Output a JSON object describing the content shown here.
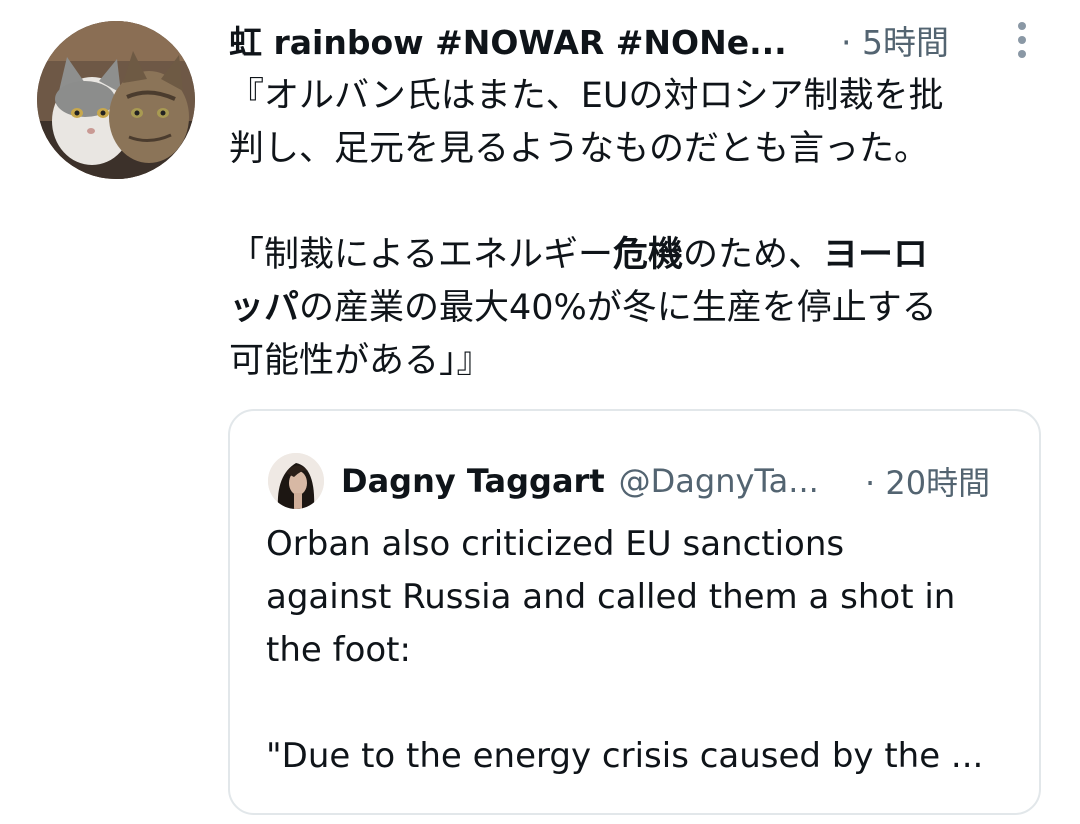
{
  "tweet": {
    "display_name": "虹 rainbow #NOWAR #NONe...",
    "timestamp": "· 5時間",
    "text": {
      "line1": "『オルバン氏はまた、EUの対ロシア制裁を批",
      "line2": "判し、足元を見るようなものだとも言った。",
      "line3a": "「制裁によるエネルギー",
      "line3b": "危機",
      "line3c": "のため、",
      "line3d": "ヨーロ",
      "line4a": "ッパ",
      "line4b": "の産業の最大40%が冬に生産を停止する",
      "line5": "可能性がある」』"
    }
  },
  "quote": {
    "display_name": "Dagny Taggart",
    "handle": "@DagnyTa...",
    "timestamp": "· 20時間",
    "text": {
      "line1": "Orban also criticized EU sanctions",
      "line2": "against Russia and called them a shot in",
      "line3": "the foot:",
      "line4": "\"Due to the energy crisis caused by the ..."
    }
  },
  "icons": {
    "avatar": "cats-avatar",
    "quote_avatar": "woman-avatar",
    "more": "more-vertical-icon"
  }
}
